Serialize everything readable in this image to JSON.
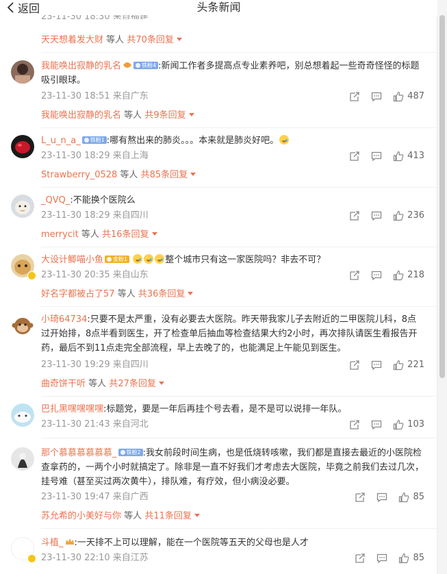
{
  "header": {
    "back_label": "返回",
    "title": "头条新闻"
  },
  "previous": {
    "meta_partial": "23-11-30 18:30 来自福建"
  },
  "comments": [
    {
      "reply_name": "天天想着发大财",
      "reply_suffix": "等人",
      "reply_count": "共70条回复"
    },
    {
      "username": "我能唤出寂静的乳名",
      "badge": "铁粉4",
      "text": ":新闻工作者多提高点专业素养吧，别总想着起一些奇奇怪怪的标题吸引眼球。",
      "time": "23-11-30 18:51",
      "location": "来自广东",
      "likes": "487",
      "reply_name": "我能唤出寂静的乳名",
      "reply_suffix": "等人",
      "reply_count": "共9条回复"
    },
    {
      "username": "L_u_n_a_",
      "badge": "铁粉1",
      "text": ":哪有熬出来的肺炎。。。本来就是肺炎好吧。",
      "time": "23-11-30 18:29",
      "location": "来自上海",
      "likes": "413",
      "reply_name": "Strawberry_0528",
      "reply_suffix": "等人",
      "reply_count": "共85条回复"
    },
    {
      "username": "_QVQ_",
      "text": ":不能换个医院么",
      "time": "23-11-30 18:29",
      "location": "来自四川",
      "likes": "236",
      "reply_name": "merrycit",
      "reply_suffix": "等人",
      "reply_count": "共16条回复"
    },
    {
      "username": "大设计鲫喵小鱼",
      "badge": "金粉1",
      "text": "整个城市只有这一家医院吗？非去不可？",
      "time": "23-11-30 20:35",
      "location": "来自山东",
      "likes": "218",
      "reply_name": "好名字都被占了57",
      "reply_suffix": "等人",
      "reply_count": "共36条回复"
    },
    {
      "username": "小琦64734",
      "text": ":只要不是太严重，没有必要去大医院。昨天带我家儿子去附近的二甲医院儿科，8点过开始排，8点半看到医生，开了检查单后抽血等检查结果大约2小时，再次排队请医生看报告开药，最后不到11点走完全部流程，早上去晚了的，也能满足上午能见到医生。",
      "time": "23-11-30 19:29",
      "location": "来自四川",
      "likes": "221",
      "reply_name": "曲奇饼干听",
      "reply_suffix": "等人",
      "reply_count": "共27条回复"
    },
    {
      "username": "巴扎黑嘿嘿嘿嘿",
      "text": ":标题党，要是一年后再挂个号去看，是不是可以说排一年队。",
      "time": "23-11-30 21:43",
      "location": "来自河北",
      "likes": "103"
    },
    {
      "username": "那个慕慕慕慕慕慕_",
      "badge": "铁粉2",
      "text": ":我女前段时间生病，也是低烧转咳嗽，我们都是直接去最近的小医院检查拿药的，一两个小时就搞定了。除非是一直不好我们才考虑去大医院，毕竟之前我们去过几次，挂号难（甚至买过两次黄牛），排队难，有疗效，但小病没必要。",
      "time": "23-11-30 19:47",
      "location": "来自广西",
      "likes": "85",
      "reply_name": "苏允希的小美好与你",
      "reply_suffix": "等人",
      "reply_count": "共11条回复"
    },
    {
      "username": "斗植_",
      "text": ":一天排不上可以理解，能在一个医院等五天的父母也是人才",
      "time": "23-11-30 22:10",
      "location": "来自江苏",
      "likes": "85"
    }
  ]
}
